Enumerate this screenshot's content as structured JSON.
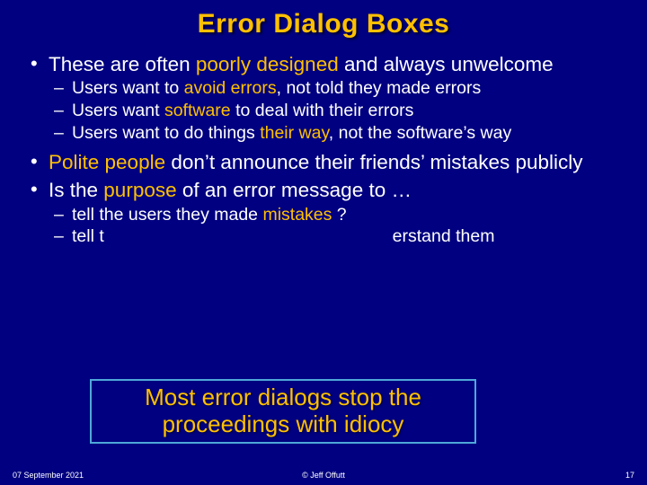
{
  "title": "Error Dialog Boxes",
  "b1": {
    "pre": "These are often ",
    "hl": "poorly designed",
    "post": " and always unwelcome"
  },
  "s1a": {
    "pre": "Users want to ",
    "hl": "avoid errors",
    "post": ", not told they made errors"
  },
  "s1b": {
    "pre": "Users want ",
    "hl": "software",
    "post": " to deal with their errors"
  },
  "s1c": {
    "pre": "Users want to do things ",
    "hl": "their way",
    "post": ", not the software’s way"
  },
  "b2": {
    "hl": "Polite people",
    "post": " don’t announce their friends’ mistakes publicly"
  },
  "b3": {
    "pre": "Is the ",
    "hl": "purpose",
    "post": " of an error message to …"
  },
  "s3a": {
    "pre": "tell the users they made ",
    "hl": "mistakes",
    "post": " ?"
  },
  "s3b": {
    "pre": "tell t",
    "post": "erstand them"
  },
  "callout": "Most error dialogs stop the proceedings with idiocy",
  "footer": {
    "date": "07 September 2021",
    "center": "© Jeff Offutt",
    "page": "17"
  }
}
